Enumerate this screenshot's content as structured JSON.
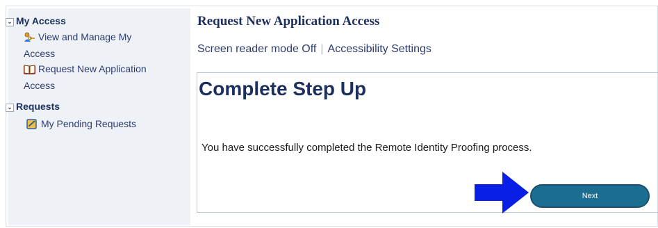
{
  "sidebar": {
    "sections": [
      {
        "title": "My Access",
        "items": [
          {
            "label_line1": "View and Manage My",
            "label_line2": "Access",
            "icon": "user-key-icon"
          },
          {
            "label_line1": "Request New Application",
            "label_line2": "Access",
            "icon": "book-icon"
          }
        ]
      },
      {
        "title": "Requests",
        "items": [
          {
            "label_line1": "My Pending Requests",
            "icon": "pending-requests-icon"
          }
        ]
      }
    ]
  },
  "main": {
    "page_title": "Request New Application Access",
    "screen_reader_link": "Screen reader mode Off",
    "separator": "|",
    "accessibility_link": "Accessibility Settings",
    "step_title": "Complete Step Up",
    "message": "You have successfully completed the Remote Identity Proofing process.",
    "next_button": "Next"
  },
  "colors": {
    "title": "#1c2f5e",
    "button": "#1b6e90",
    "arrow": "#0a1fe6",
    "sidebar_bg": "#eef1f6"
  }
}
